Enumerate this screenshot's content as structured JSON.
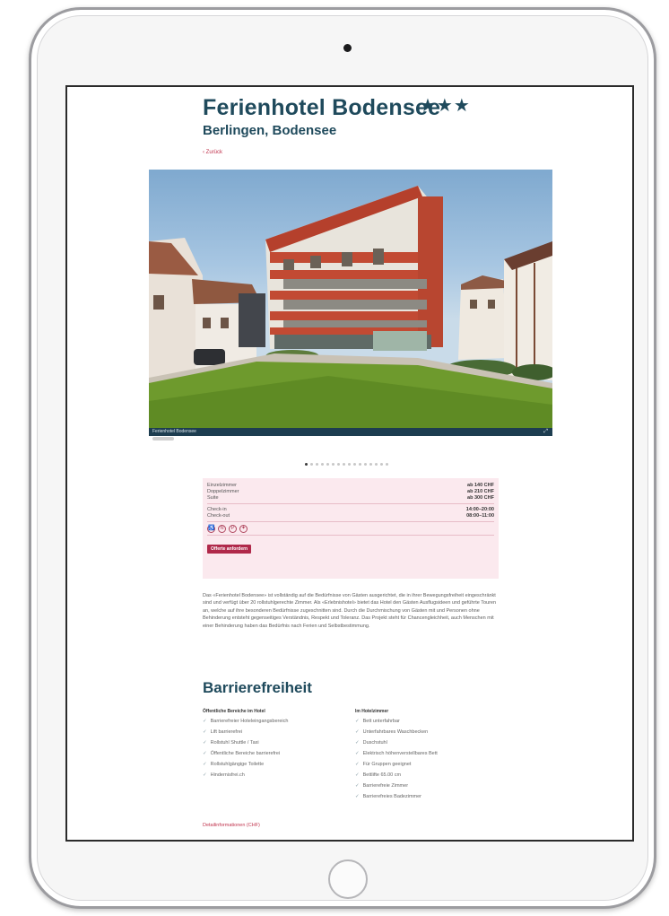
{
  "hotel": {
    "name": "Ferienhotel Bodensee",
    "stars": "★★★",
    "location": "Berlingen, Bodensee",
    "back_link": "‹ Zurück"
  },
  "photo": {
    "caption": "Ferienhotel Bodensee",
    "slide_count": 16,
    "active_slide": 1
  },
  "rates": [
    {
      "label": "Einzelzimmer",
      "price": "ab 140 CHF"
    },
    {
      "label": "Doppelzimmer",
      "price": "ab 210 CHF"
    },
    {
      "label": "Suite",
      "price": "ab 300 CHF"
    }
  ],
  "times": [
    {
      "label": "Check-in",
      "value": "14:00–20:00"
    },
    {
      "label": "Check-out",
      "value": "08:00–11:00"
    }
  ],
  "amenity_icons": [
    "wheelchair-icon",
    "wifi-icon",
    "parking-icon",
    "restaurant-icon"
  ],
  "offer_button": "Offerte anfordern",
  "description": "Das «Ferienhotel Bodensee» ist vollständig auf die Bedürfnisse von Gästen ausgerichtet, die in ihrer Bewegungsfreiheit eingeschränkt sind und verfügt über 20 rollstuhlgerechte Zimmer. Als «Erlebnishotel» bietet das Hotel den Gästen Ausflugsideen und geführte Touren an, welche auf ihre besonderen Bedürfnisse zugeschnitten sind. Durch die Durchmischung von Gästen mit und Personen ohne Behinderung entsteht gegenseitiges Verständnis, Respekt und Toleranz. Das Projekt steht für Chancengleichheit, auch Menschen mit einer Behinderung haben das Bedürfnis nach Ferien und Selbstbestimmung.",
  "accessibility": {
    "title": "Barrierefreiheit",
    "public_areas": {
      "heading": "Öffentliche Bereiche im Hotel",
      "items": [
        "Barrierefreier Hoteleingangsbereich",
        "Lift barrierefrei",
        "Rollstuhl Shuttle / Taxi",
        "Öffentliche Bereiche barrierefrei",
        "Rollstuhlgängige Toilette",
        "Hindernisfrei.ch"
      ]
    },
    "rooms": {
      "heading": "Im Hotelzimmer",
      "items": [
        "Bett unterfahrbar",
        "Unterfahrbares Waschbecken",
        "Duschstuhl",
        "Elektrisch höhenverstellbares Bett",
        "Für Gruppen geeignet",
        "Bettlifte 65.00 cm",
        "Barrierefreie Zimmer",
        "Barrierefreies Badezimmer"
      ]
    }
  },
  "more_link": "Detailinformationen (CHF)"
}
